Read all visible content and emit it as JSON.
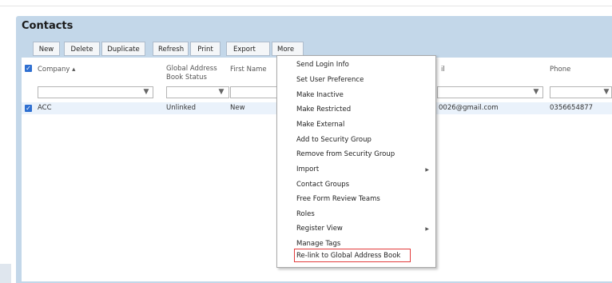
{
  "page_title": "Contacts",
  "toolbar": {
    "new": "New",
    "delete": "Delete",
    "duplicate": "Duplicate",
    "refresh": "Refresh",
    "print": "Print",
    "export": "Export",
    "more": "More"
  },
  "columns": {
    "company": "Company ▴",
    "global_address": "Global Address Book Status",
    "first_name": "First Name",
    "email_partial": "il",
    "phone": "Phone"
  },
  "row": {
    "company": "ACC",
    "status": "Unlinked",
    "first_name": "New",
    "email": "0026@gmail.com",
    "phone": "0356654877"
  },
  "menu": [
    "Send Login Info",
    "Set User Preference",
    "Make Inactive",
    "Make Restricted",
    "Make External",
    "Add to Security Group",
    "Remove from Security Group",
    "Import",
    "Contact Groups",
    "Free Form Review Teams",
    "Roles",
    "Register View",
    "Manage Tags",
    "Re-link to Global Address Book"
  ],
  "colors": {
    "accent": "#2e6fd1",
    "highlight": "#e23b3b",
    "panel": "#c3d7e9"
  }
}
